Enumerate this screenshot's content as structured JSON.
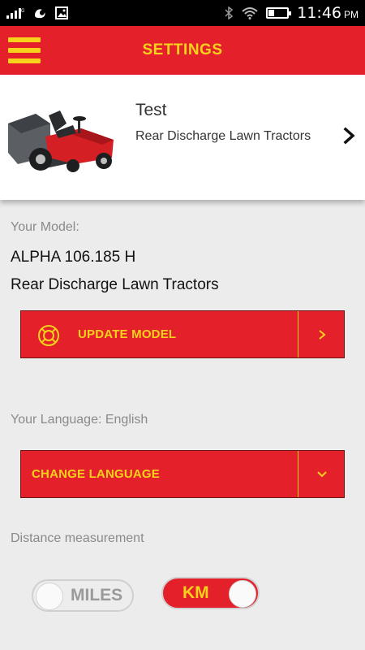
{
  "status_bar": {
    "time": "11:46",
    "ampm": "PM",
    "icons": [
      "signal-icon",
      "uc-browser-icon",
      "image-icon",
      "bluetooth-icon",
      "wifi-icon",
      "battery-icon"
    ]
  },
  "app_bar": {
    "title": "SETTINGS",
    "menu_icon": "hamburger-menu-icon"
  },
  "model_card": {
    "name": "Test",
    "category": "Rear Discharge Lawn Tractors",
    "image": "lawn-tractor-image",
    "chevron_icon": "chevron-right-icon"
  },
  "model_section": {
    "label": "Your Model:",
    "model_name": "ALPHA 106.185 H",
    "model_category": "Rear Discharge Lawn Tractors",
    "update_button": {
      "label": "UPDATE MODEL",
      "icon": "lifebuoy-icon",
      "tail_icon": "chevron-right-icon"
    }
  },
  "language_section": {
    "label": "Your Language: English",
    "change_button": {
      "label": "CHANGE LANGUAGE",
      "tail_icon": "chevron-down-icon"
    }
  },
  "distance_section": {
    "label": "Distance measurement",
    "miles_toggle": {
      "label": "MILES",
      "selected": false
    },
    "km_toggle": {
      "label": "KM",
      "selected": true
    }
  },
  "colors": {
    "brand_red": "#e4202a",
    "brand_yellow": "#f6d21c",
    "background": "#ececec"
  }
}
